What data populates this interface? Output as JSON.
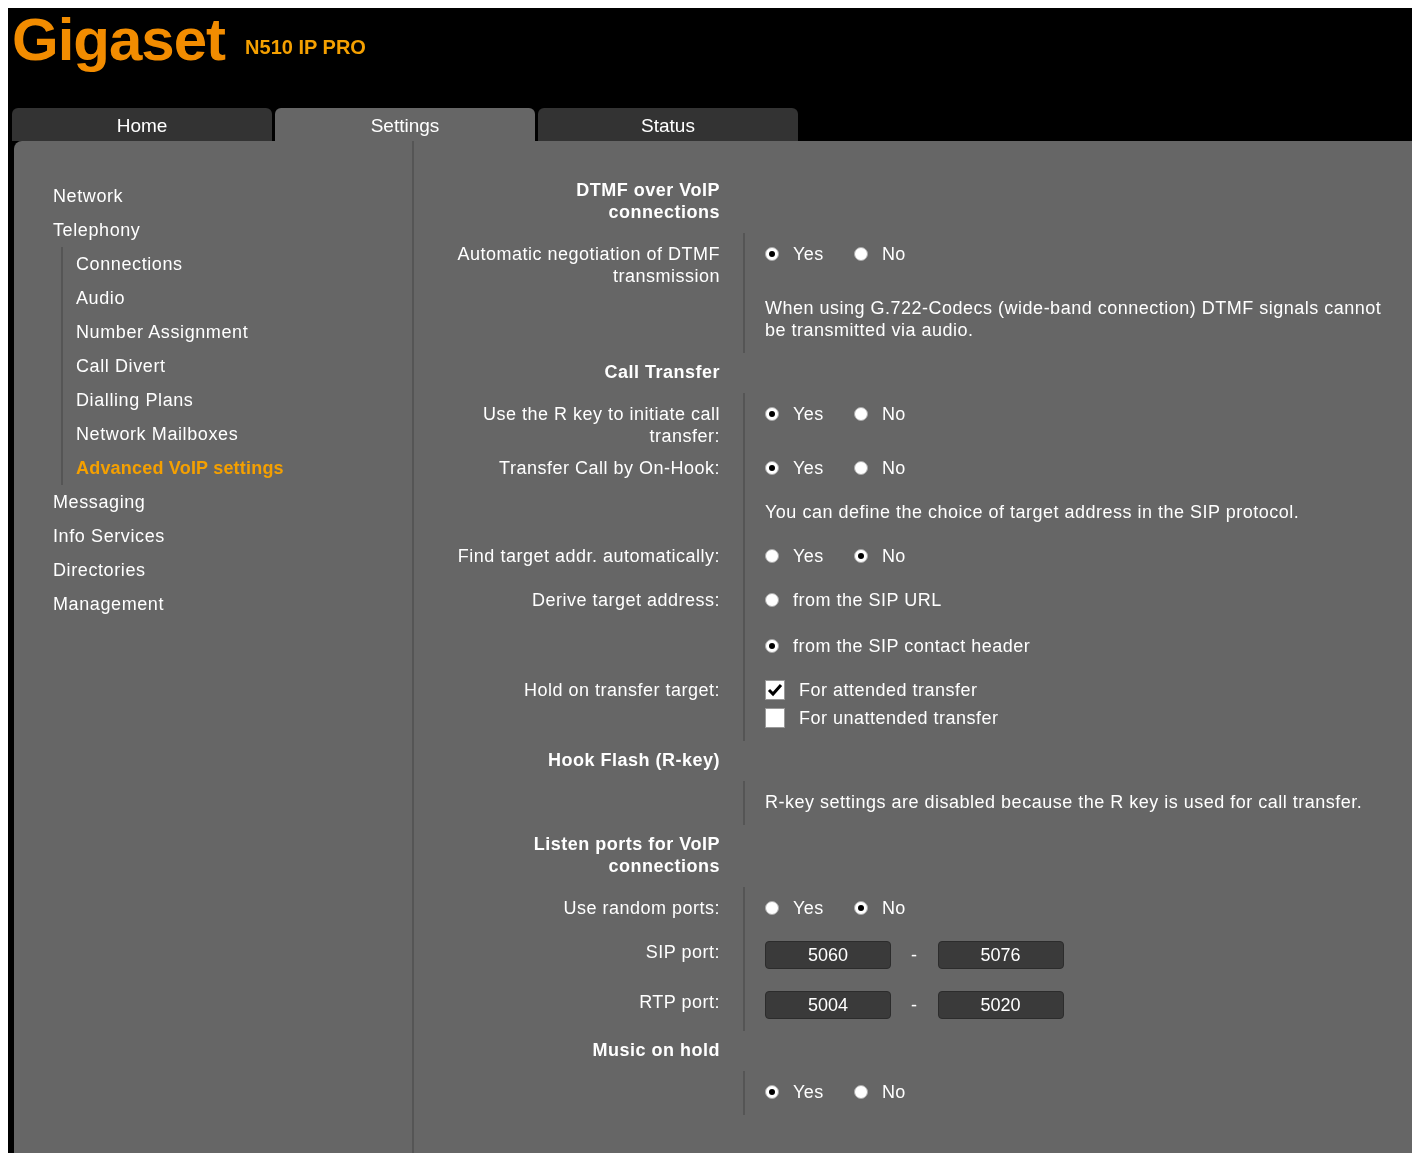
{
  "header": {
    "logo": "Gigaset",
    "model": "N510 IP PRO"
  },
  "tabs": [
    {
      "label": "Home",
      "selected": false
    },
    {
      "label": "Settings",
      "selected": true
    },
    {
      "label": "Status",
      "selected": false
    }
  ],
  "sidebar": {
    "items": [
      {
        "label": "Network",
        "selected": false
      },
      {
        "label": "Telephony",
        "selected": false,
        "children": [
          {
            "label": "Connections",
            "selected": false
          },
          {
            "label": "Audio",
            "selected": false
          },
          {
            "label": "Number Assignment",
            "selected": false
          },
          {
            "label": "Call Divert",
            "selected": false
          },
          {
            "label": "Dialling Plans",
            "selected": false
          },
          {
            "label": "Network Mailboxes",
            "selected": false
          },
          {
            "label": "Advanced VoIP settings",
            "selected": true
          }
        ]
      },
      {
        "label": "Messaging",
        "selected": false
      },
      {
        "label": "Info Services",
        "selected": false
      },
      {
        "label": "Directories",
        "selected": false
      },
      {
        "label": "Management",
        "selected": false
      }
    ]
  },
  "sections": [
    {
      "heading": "DTMF over VoIP connections",
      "rows": [
        {
          "kind": "radio",
          "label": "Automatic negotiation of DTMF transmission",
          "options": [
            {
              "label": "Yes",
              "selected": true
            },
            {
              "label": "No",
              "selected": false
            }
          ]
        },
        {
          "kind": "note",
          "text": "When using G.722-Codecs (wide-band connection) DTMF signals cannot be transmitted via audio."
        }
      ]
    },
    {
      "heading": "Call Transfer",
      "rows": [
        {
          "kind": "radio",
          "label": "Use the R key to initiate call transfer:",
          "options": [
            {
              "label": "Yes",
              "selected": true
            },
            {
              "label": "No",
              "selected": false
            }
          ]
        },
        {
          "kind": "radio",
          "label": "Transfer Call by On-Hook:",
          "options": [
            {
              "label": "Yes",
              "selected": true
            },
            {
              "label": "No",
              "selected": false
            }
          ]
        },
        {
          "kind": "note",
          "text": "You can define the choice of target address in the SIP protocol."
        },
        {
          "kind": "radio",
          "label": "Find target addr. automatically:",
          "options": [
            {
              "label": "Yes",
              "selected": false
            },
            {
              "label": "No",
              "selected": true
            }
          ]
        },
        {
          "kind": "radiolist",
          "label": "Derive target address:",
          "options": [
            {
              "label": "from the SIP URL",
              "selected": false
            },
            {
              "label": "from the SIP contact header",
              "selected": true
            }
          ]
        },
        {
          "kind": "checkbox",
          "label": "Hold on transfer target:",
          "options": [
            {
              "label": "For attended transfer",
              "checked": true
            },
            {
              "label": "For unattended transfer",
              "checked": false
            }
          ]
        }
      ]
    },
    {
      "heading": "Hook Flash (R-key)",
      "rows": [
        {
          "kind": "note",
          "text": "R-key settings are disabled because the R key is used for call transfer."
        }
      ]
    },
    {
      "heading": "Listen ports for VoIP connections",
      "rows": [
        {
          "kind": "radio",
          "label": "Use random ports:",
          "options": [
            {
              "label": "Yes",
              "selected": false
            },
            {
              "label": "No",
              "selected": true
            }
          ]
        },
        {
          "kind": "ports",
          "label": "SIP port:",
          "from": "5060",
          "separator": "-",
          "to": "5076"
        },
        {
          "kind": "ports",
          "label": "RTP port:",
          "from": "5004",
          "separator": "-",
          "to": "5020"
        }
      ]
    },
    {
      "heading": "Music on hold",
      "rows": [
        {
          "kind": "radio",
          "options": [
            {
              "label": "Yes",
              "selected": true
            },
            {
              "label": "No",
              "selected": false
            }
          ]
        }
      ]
    }
  ]
}
